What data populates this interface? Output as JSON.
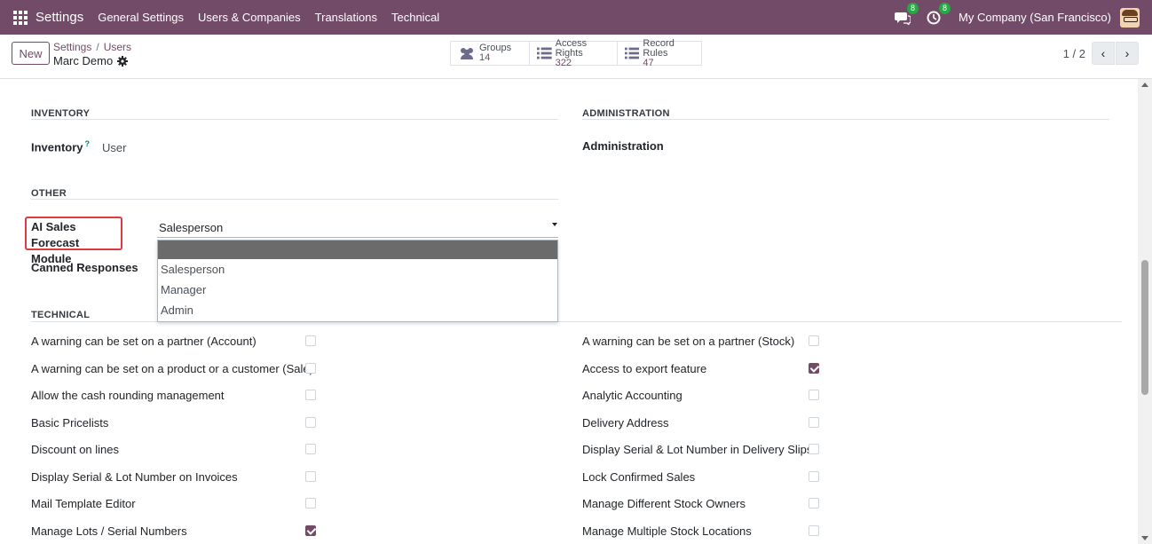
{
  "navbar": {
    "brand": "Settings",
    "menu": [
      "General Settings",
      "Users & Companies",
      "Translations",
      "Technical"
    ],
    "messages_badge": "8",
    "activities_badge": "8",
    "company": "My Company (San Francisco)"
  },
  "control": {
    "new_label": "New",
    "breadcrumb": [
      "Settings",
      "Users"
    ],
    "record_name": "Marc Demo",
    "smart_buttons": [
      {
        "label": "Groups",
        "count": "14"
      },
      {
        "label": "Access Rights",
        "count": "322"
      },
      {
        "label": "Record Rules",
        "count": "47"
      }
    ],
    "pager": "1 / 2"
  },
  "sections": {
    "inventory_title": "INVENTORY",
    "inventory_label": "Inventory",
    "inventory_help": "?",
    "inventory_value": "User",
    "administration_title": "ADMINISTRATION",
    "administration_label": "Administration",
    "other_title": "OTHER",
    "ai_label": "AI Sales Forecast Module",
    "ai_value": "Salesperson",
    "canned_label": "Canned Responses",
    "technical_title": "TECHNICAL"
  },
  "dropdown_options": [
    "Salesperson",
    "Manager",
    "Admin"
  ],
  "technical": {
    "left": [
      {
        "label": "A warning can be set on a partner (Account)",
        "checked": false
      },
      {
        "label": "A warning can be set on a product or a customer (Sale)",
        "checked": false
      },
      {
        "label": "Allow the cash rounding management",
        "checked": false
      },
      {
        "label": "Basic Pricelists",
        "checked": false
      },
      {
        "label": "Discount on lines",
        "checked": false
      },
      {
        "label": "Display Serial & Lot Number on Invoices",
        "checked": false
      },
      {
        "label": "Mail Template Editor",
        "checked": false
      },
      {
        "label": "Manage Lots / Serial Numbers",
        "checked": true
      }
    ],
    "right": [
      {
        "label": "A warning can be set on a partner (Stock)",
        "checked": false
      },
      {
        "label": "Access to export feature",
        "checked": true
      },
      {
        "label": "Analytic Accounting",
        "checked": false
      },
      {
        "label": "Delivery Address",
        "checked": false
      },
      {
        "label": "Display Serial & Lot Number in Delivery Slips",
        "checked": false
      },
      {
        "label": "Lock Confirmed Sales",
        "checked": false
      },
      {
        "label": "Manage Different Stock Owners",
        "checked": false
      },
      {
        "label": "Manage Multiple Stock Locations",
        "checked": false
      }
    ]
  },
  "colors": {
    "brand": "#714b67",
    "highlight": "#e0393e",
    "badge": "#28a745"
  }
}
